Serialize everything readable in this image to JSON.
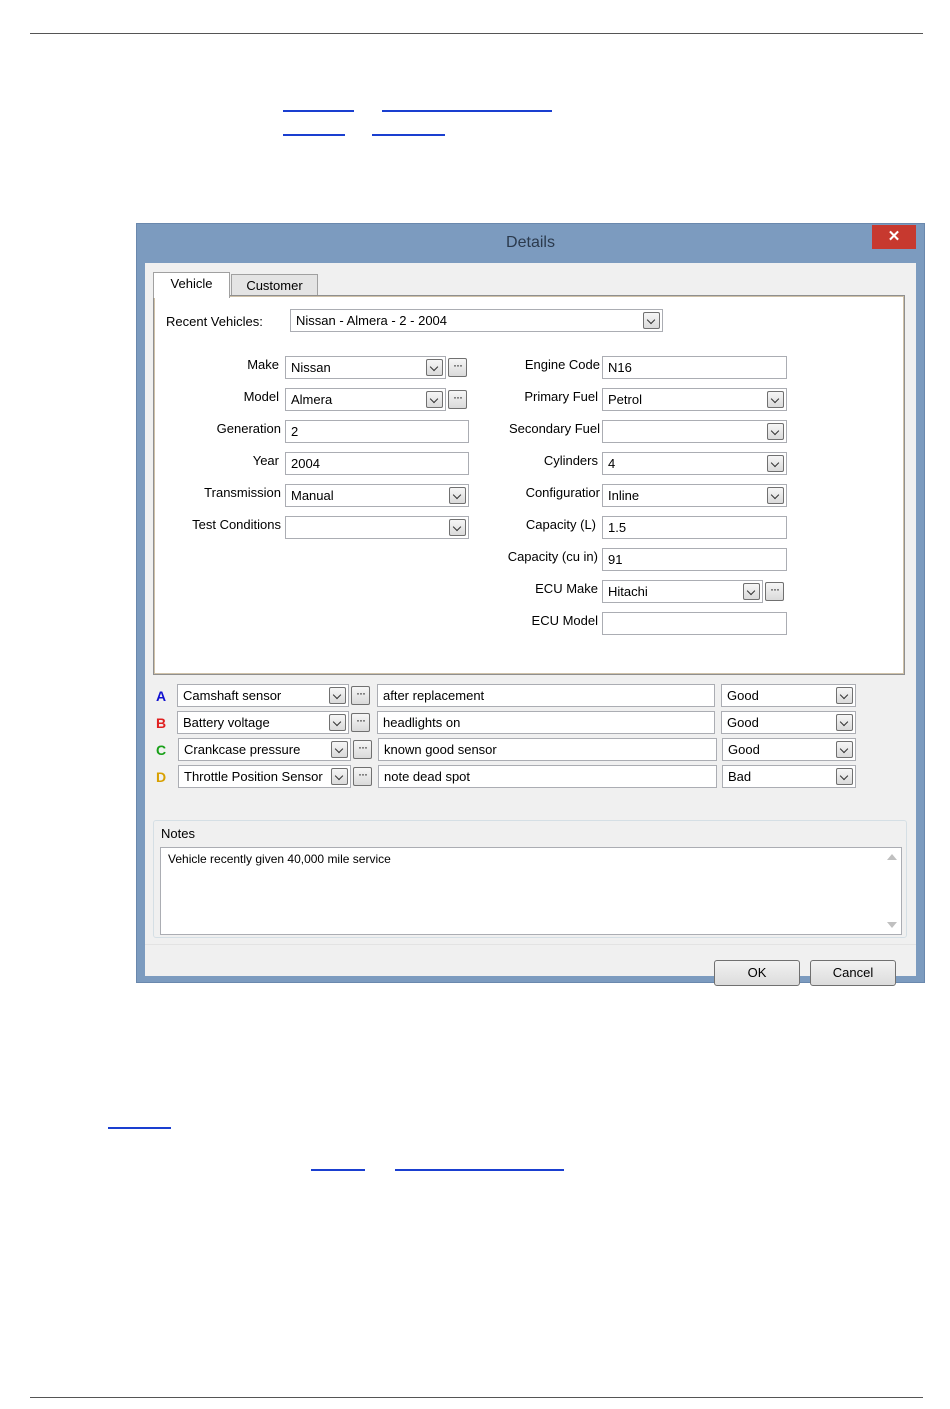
{
  "dialog": {
    "title": "Details",
    "close_glyph": "✕",
    "tabs": [
      {
        "label": "Vehicle",
        "active": true
      },
      {
        "label": "Customer",
        "active": false
      }
    ],
    "recent": {
      "label": "Recent Vehicles:",
      "value": "Nissan - Almera - 2 - 2004"
    },
    "left_fields": [
      {
        "label": "Make",
        "value": "Nissan"
      },
      {
        "label": "Model",
        "value": "Almera"
      },
      {
        "label": "Generation",
        "value": "2"
      },
      {
        "label": "Year",
        "value": "2004"
      },
      {
        "label": "Transmission",
        "value": "Manual"
      },
      {
        "label": "Test Conditions",
        "value": ""
      }
    ],
    "right_fields": [
      {
        "label": "Engine Code",
        "value": "N16"
      },
      {
        "label": "Primary Fuel",
        "value": "Petrol"
      },
      {
        "label": "Secondary Fuel",
        "value": ""
      },
      {
        "label": "Cylinders",
        "value": "4"
      },
      {
        "label": "Configuratior",
        "value": "Inline"
      },
      {
        "label": "Capacity (L)",
        "value": "1.5"
      },
      {
        "label": "Capacity (cu in)",
        "value": "91"
      },
      {
        "label": "ECU Make",
        "value": "Hitachi"
      },
      {
        "label": "ECU Model",
        "value": ""
      }
    ],
    "channels": [
      {
        "letter": "A",
        "color": "#1010d0",
        "probe": "Camshaft sensor",
        "note": "after replacement",
        "status": "Good"
      },
      {
        "letter": "B",
        "color": "#e02020",
        "probe": "Battery voltage",
        "note": "headlights on",
        "status": "Good"
      },
      {
        "letter": "C",
        "color": "#18a018",
        "probe": "Crankcase pressure",
        "note": "known good sensor",
        "status": "Good"
      },
      {
        "letter": "D",
        "color": "#d8a000",
        "probe": "Throttle Position Sensor",
        "note": "note dead spot",
        "status": "Bad"
      }
    ],
    "notes": {
      "label": "Notes",
      "text": "Vehicle recently given 40,000 mile service"
    },
    "buttons": {
      "ok": "OK",
      "cancel": "Cancel"
    },
    "more_glyph": "···"
  }
}
